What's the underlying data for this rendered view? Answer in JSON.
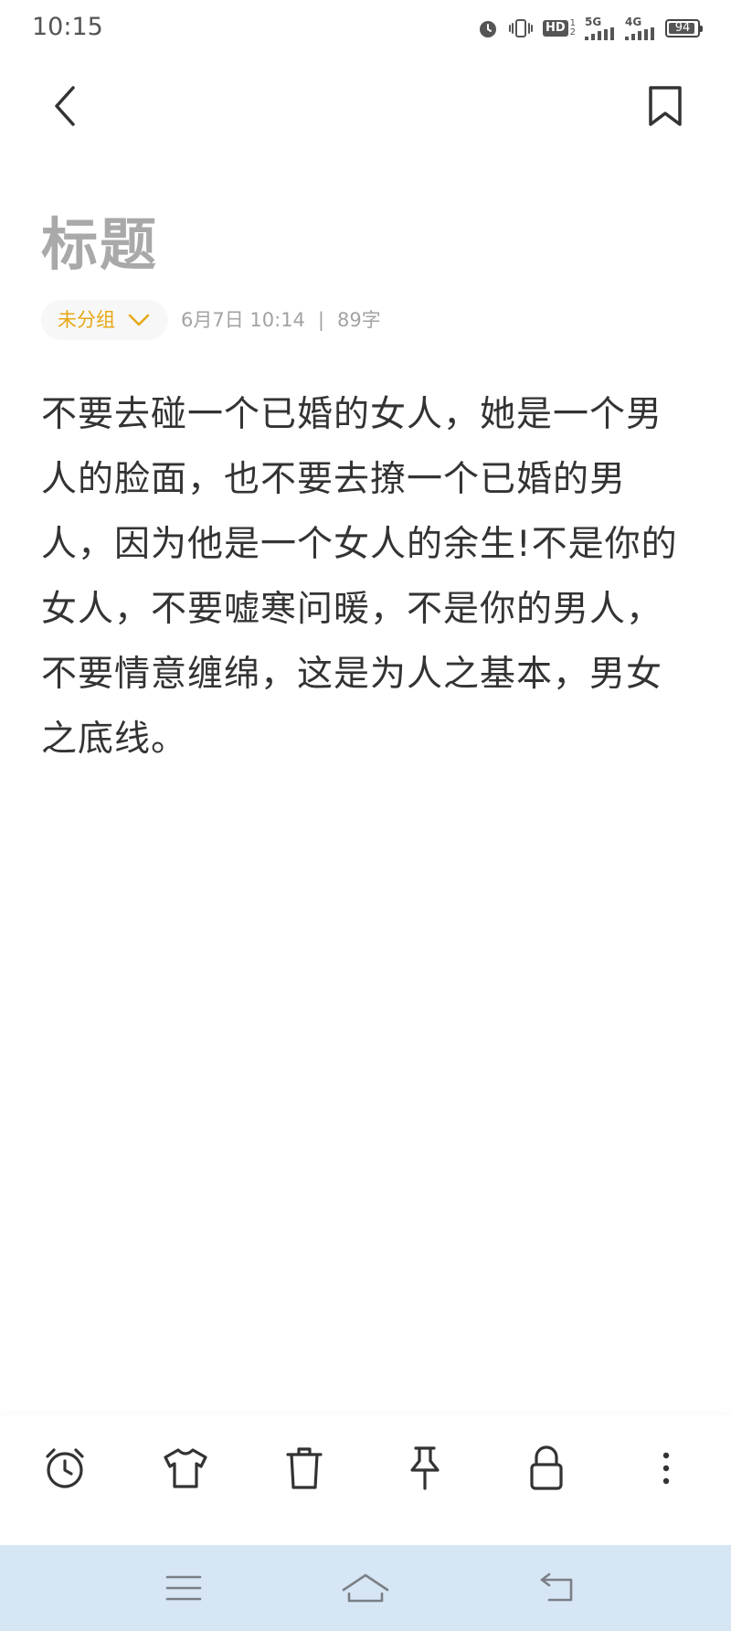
{
  "status_bar": {
    "time": "10:15",
    "hd_label": "HD",
    "net_5g": "5G",
    "net_4g": "4G",
    "battery_level": "94"
  },
  "header": {
    "back_icon": "chevron-left-icon",
    "bookmark_icon": "bookmark-icon"
  },
  "note": {
    "title": "标题",
    "group_label": "未分组",
    "date_time": "6月7日 10:14",
    "separator": "|",
    "char_count": "89字",
    "body": "不要去碰一个已婚的女人，她是一个男人的脸面，也不要去撩一个已婚的男人，因为他是一个女人的余生!不是你的女人，不要嘘寒问暖，不是你的男人，不要情意缠绵，这是为人之基本，男女之底线。"
  },
  "toolbar": {
    "icons": [
      "alarm-clock-icon",
      "shirt-icon",
      "trash-icon",
      "pin-icon",
      "lock-icon",
      "more-vertical-icon"
    ]
  },
  "nav_bar": {
    "icons": [
      "menu-icon",
      "home-icon",
      "back-icon"
    ]
  },
  "colors": {
    "accent": "#e6a817",
    "title_gray": "#a9a9a9",
    "meta_gray": "#a3a3a3",
    "nav_bar_bg": "#d6e6f4"
  }
}
